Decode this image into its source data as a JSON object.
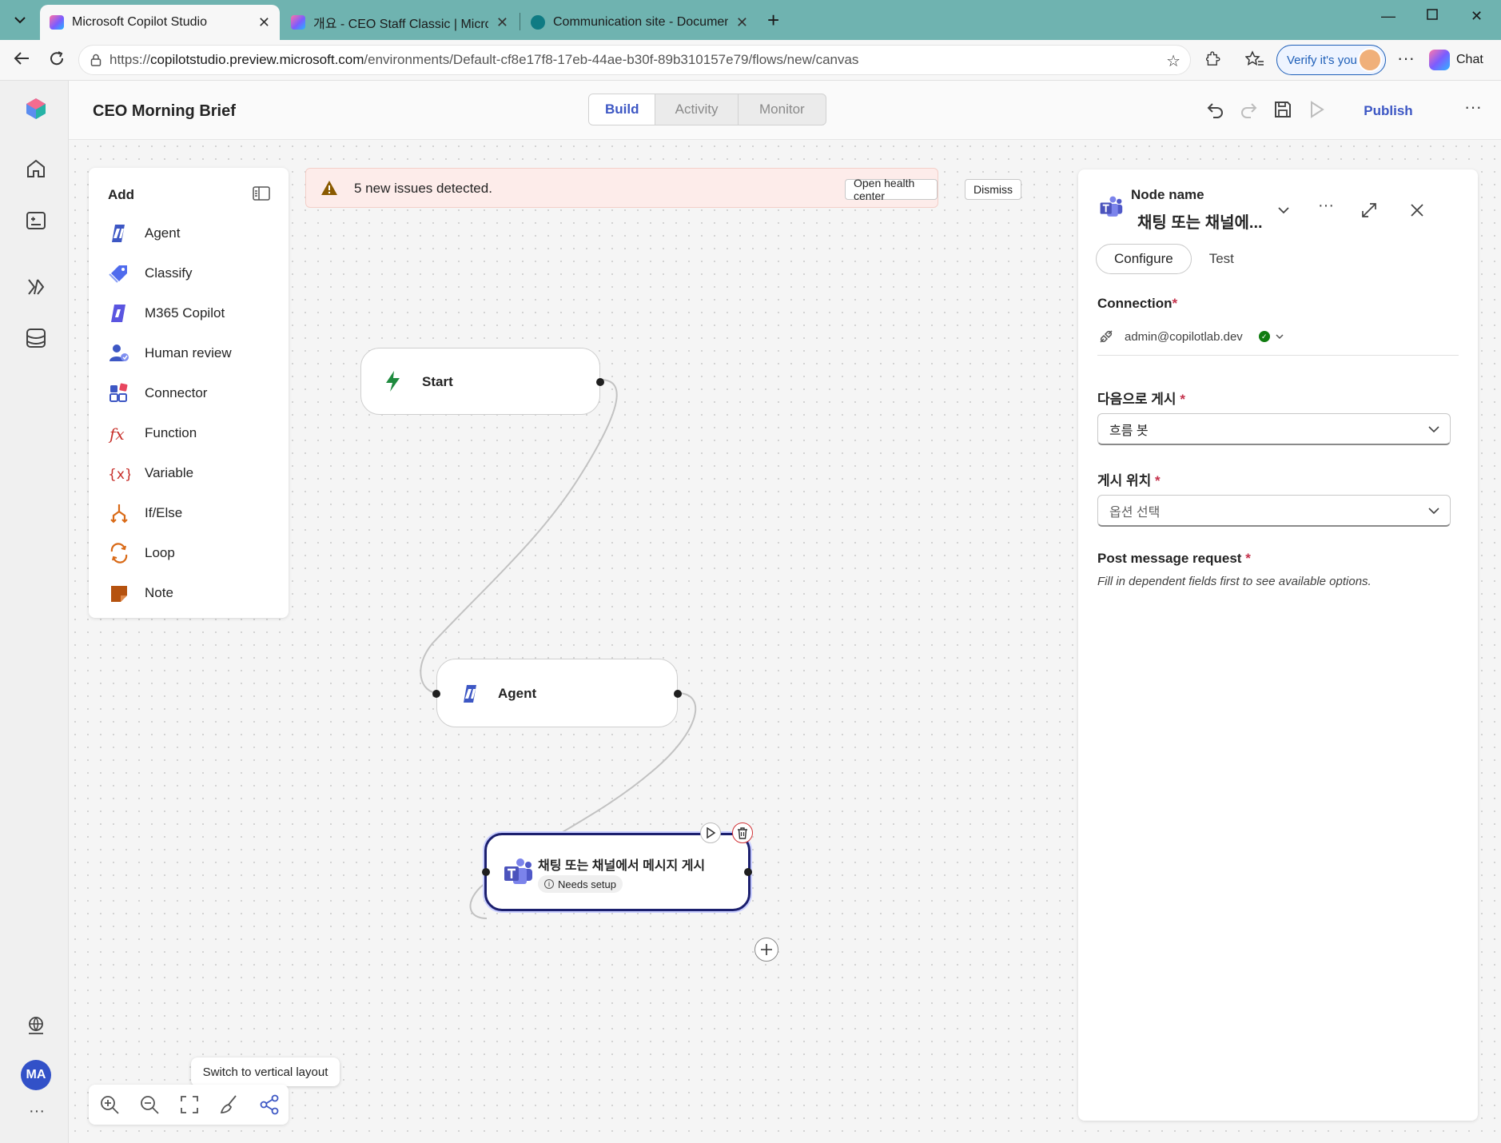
{
  "browser": {
    "tabs": [
      {
        "title": "Microsoft Copilot Studio",
        "active": true
      },
      {
        "title": "개요 - CEO Staff Classic | Microsoft",
        "active": false
      },
      {
        "title": "Communication site - Documents",
        "active": false
      }
    ],
    "url_prefix": "https://",
    "url_domain": "copilotstudio.preview.microsoft.com",
    "url_path": "/environments/Default-cf8e17f8-17eb-44ae-b30f-89b310157e79/flows/new/canvas",
    "verify_label": "Verify it's you",
    "chat_label": "Chat"
  },
  "topbar": {
    "title": "CEO Morning Brief",
    "mode_tabs": [
      "Build",
      "Activity",
      "Monitor"
    ],
    "publish_label": "Publish"
  },
  "rail": {
    "avatar_initials": "MA"
  },
  "add_panel": {
    "title": "Add",
    "items": [
      {
        "label": "Agent",
        "icon": "agent-icon"
      },
      {
        "label": "Classify",
        "icon": "tag-icon"
      },
      {
        "label": "M365 Copilot",
        "icon": "m365-copilot-icon"
      },
      {
        "label": "Human review",
        "icon": "human-review-icon"
      },
      {
        "label": "Connector",
        "icon": "connector-icon"
      },
      {
        "label": "Function",
        "icon": "function-icon"
      },
      {
        "label": "Variable",
        "icon": "variable-icon"
      },
      {
        "label": "If/Else",
        "icon": "branch-icon"
      },
      {
        "label": "Loop",
        "icon": "loop-icon"
      },
      {
        "label": "Note",
        "icon": "note-icon"
      }
    ]
  },
  "banner": {
    "text": "5 new issues detected.",
    "open_label": "Open health center",
    "dismiss_label": "Dismiss"
  },
  "nodes": {
    "start": {
      "label": "Start"
    },
    "agent": {
      "label": "Agent"
    },
    "teams": {
      "label": "채팅 또는 채널에서 메시지 게시",
      "badge": "Needs setup"
    }
  },
  "zoom_bar": {
    "tooltip": "Switch to vertical layout"
  },
  "right_panel": {
    "caption": "Node name",
    "name": "채팅 또는 채널에...",
    "tabs": [
      "Configure",
      "Test"
    ],
    "connection_label": "Connection",
    "connection_value": "admin@copilotlab.dev",
    "post_as_label": "다음으로 게시",
    "post_as_value": "흐름 봇",
    "post_in_label": "게시 위치",
    "post_in_placeholder": "옵션 선택",
    "request_label": "Post message request",
    "request_hint": "Fill in dependent fields first to see available options.",
    "required_mark": "*"
  },
  "colors": {
    "accent": "#3d57c4",
    "browser_frame": "#6fb3b0",
    "warning_bg": "#fdecea",
    "selected_border": "#1b1f6e",
    "status_ok": "#107c10"
  }
}
